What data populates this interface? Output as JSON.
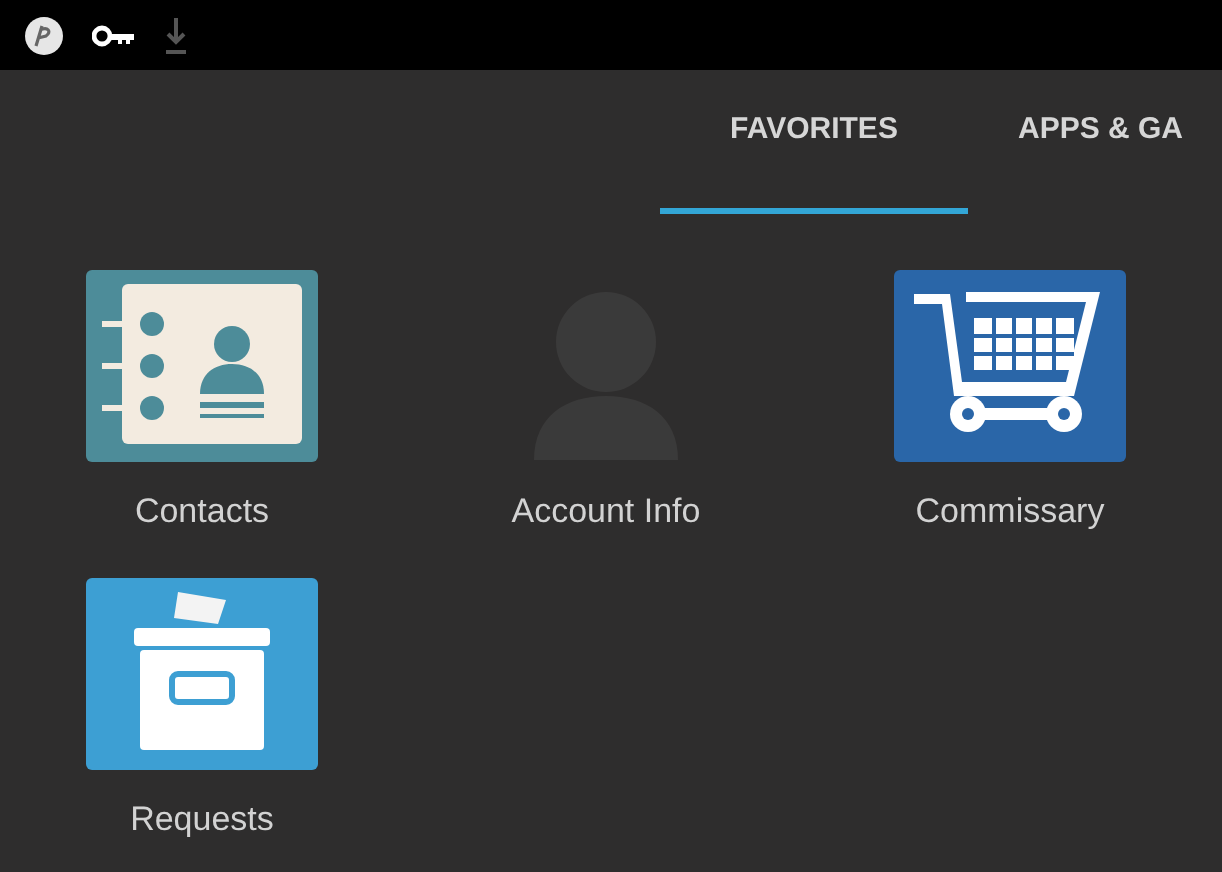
{
  "status_bar": {
    "icons": [
      {
        "kind": "logo"
      },
      {
        "kind": "key"
      },
      {
        "kind": "download"
      }
    ]
  },
  "tabs": [
    {
      "label": "FAVORITES",
      "selected": true
    },
    {
      "label": "APPS & GA",
      "selected": false
    }
  ],
  "apps": [
    {
      "label": "Contacts",
      "kind": "contacts",
      "disabled": false
    },
    {
      "label": "Account Info",
      "kind": "person",
      "disabled": true
    },
    {
      "label": "Commissary",
      "kind": "cart",
      "disabled": false
    },
    {
      "label": "Requests",
      "kind": "box",
      "disabled": false
    }
  ]
}
